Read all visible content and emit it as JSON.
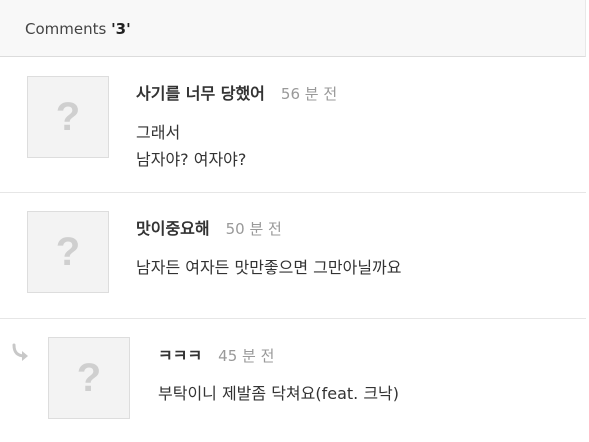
{
  "header": {
    "label": "Comments ",
    "count": "'3'"
  },
  "comments": [
    {
      "author": "사기를 너무 당했어",
      "time": "56 분 전",
      "lines": [
        "그래서",
        "남자야? 여자야?"
      ],
      "avatar_glyph": "?"
    },
    {
      "author": "맛이중요해",
      "time": "50 분 전",
      "lines": [
        "남자든 여자든 맛만좋으면 그만아닐까요"
      ],
      "avatar_glyph": "?"
    },
    {
      "author": "ㅋㅋㅋ",
      "time": "45 분 전",
      "lines": [
        "부탁이니 제발좀 닥쳐요(feat. 크낙)"
      ],
      "avatar_glyph": "?",
      "is_reply": true
    }
  ],
  "icons": {
    "reply": "reply-arrow-icon",
    "avatar": "default-avatar-icon"
  },
  "colors": {
    "header_bg": "#f8f8f8",
    "time_text": "#999999",
    "avatar_bg": "#f3f3f3",
    "avatar_glyph": "#cfcfcf"
  }
}
